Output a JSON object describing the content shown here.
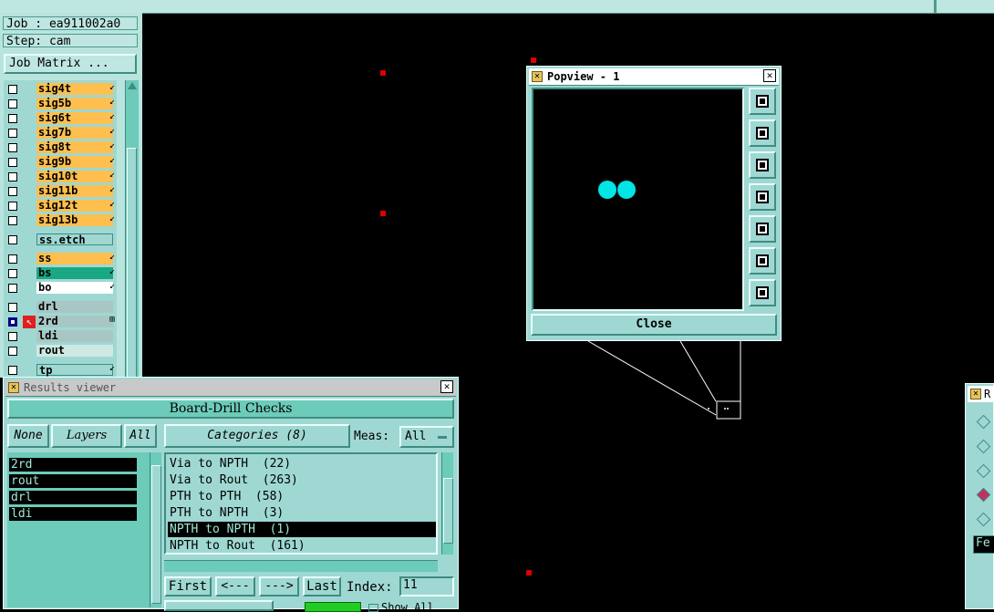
{
  "left_panel": {
    "job_line": "Job : ea911002a0",
    "step_line": "Step: cam",
    "job_matrix_button": "Job Matrix ...",
    "layers": [
      {
        "name": "sig4t",
        "style": "orange",
        "flag": "↙",
        "checked": false
      },
      {
        "name": "sig5b",
        "style": "orange",
        "flag": "↙",
        "checked": false
      },
      {
        "name": "sig6t",
        "style": "orange",
        "flag": "↙",
        "checked": false
      },
      {
        "name": "sig7b",
        "style": "orange",
        "flag": "↙",
        "checked": false
      },
      {
        "name": "sig8t",
        "style": "orange",
        "flag": "↙",
        "checked": false
      },
      {
        "name": "sig9b",
        "style": "orange",
        "flag": "↙",
        "checked": false
      },
      {
        "name": "sig10t",
        "style": "orange",
        "flag": "↙",
        "checked": false
      },
      {
        "name": "sig11b",
        "style": "orange",
        "flag": "↙",
        "checked": false
      },
      {
        "name": "sig12t",
        "style": "orange",
        "flag": "↙",
        "checked": false
      },
      {
        "name": "sig13b",
        "style": "orange",
        "flag": "↙",
        "checked": false
      },
      {
        "name": "ss.etch",
        "style": "tealname",
        "flag": "",
        "checked": false
      },
      {
        "name": "ss",
        "style": "orange",
        "flag": "↙",
        "checked": false
      },
      {
        "name": "bs",
        "style": "greenish",
        "flag": "↙",
        "checked": false
      },
      {
        "name": "bo",
        "style": "white",
        "flag": "↙",
        "checked": false
      },
      {
        "name": "drl",
        "style": "greyish",
        "flag": "",
        "checked": false
      },
      {
        "name": "2rd",
        "style": "greyish",
        "flag": "⊞",
        "checked": true
      },
      {
        "name": "ldi",
        "style": "greyish",
        "flag": "",
        "checked": false
      },
      {
        "name": "rout",
        "style": "lightg",
        "flag": "",
        "checked": false
      },
      {
        "name": "tp",
        "style": "tealname",
        "flag": "↙",
        "checked": false
      }
    ]
  },
  "popview": {
    "title": "Popview - 1",
    "close_button": "Close",
    "tools": [
      "zoom-window-icon",
      "pan-up-icon",
      "pan-down-icon",
      "pan-left-icon",
      "pan-right-icon",
      "zoom-in-icon",
      "zoom-out-icon"
    ]
  },
  "results_viewer": {
    "title": "Results viewer",
    "header": "Board-Drill Checks",
    "none_button": "None",
    "layers_button": "Layers",
    "all_button": "All",
    "categories_button": "Categories (8)",
    "meas_label": "Meas:",
    "meas_value": "All",
    "layers": [
      "2rd",
      "rout",
      "drl",
      "ldi"
    ],
    "categories": [
      {
        "label": "Via to NPTH  (22)",
        "selected": false
      },
      {
        "label": "Via to Rout  (263)",
        "selected": false
      },
      {
        "label": "PTH to PTH  (58)",
        "selected": false
      },
      {
        "label": "PTH to NPTH  (3)",
        "selected": false
      },
      {
        "label": "NPTH to NPTH  (1)",
        "selected": true
      },
      {
        "label": "NPTH to Rout  (161)",
        "selected": false
      }
    ],
    "first_button": "First",
    "prev_button": "<---",
    "next_button": "--->",
    "last_button": "Last",
    "index_label": "Index:",
    "index_value": "11",
    "show_all_label": "Show All"
  },
  "right_window": {
    "title_fragment": "R",
    "field_fragment": "Fe"
  }
}
